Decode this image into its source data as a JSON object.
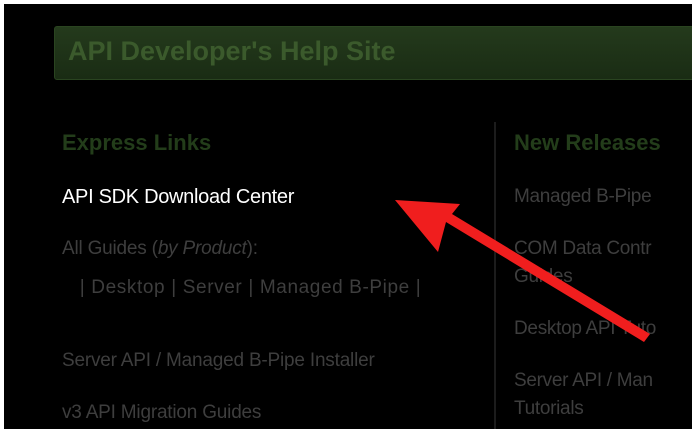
{
  "header": {
    "title": "API Developer's Help Site"
  },
  "express_links": {
    "heading": "Express Links",
    "download_center": "API SDK Download Center",
    "all_guides_prefix": "All Guides (",
    "all_guides_by_product": "by Product",
    "all_guides_suffix": "):",
    "products": [
      {
        "label": "Desktop"
      },
      {
        "label": "Server"
      },
      {
        "label": "Managed B-Pipe"
      }
    ],
    "installer": "Server API / Managed B-Pipe Installer",
    "migration": "v3 API Migration Guides"
  },
  "new_releases": {
    "heading": "New Releases",
    "items": [
      {
        "label": "Managed B-Pipe"
      },
      {
        "label": "COM Data Contr"
      },
      {
        "label": "Guides"
      },
      {
        "label": "Desktop API Tuto"
      },
      {
        "label": "Server API / Man"
      },
      {
        "label": "Tutorials"
      }
    ]
  },
  "annotation": {
    "arrow_color": "#f01e1e"
  }
}
